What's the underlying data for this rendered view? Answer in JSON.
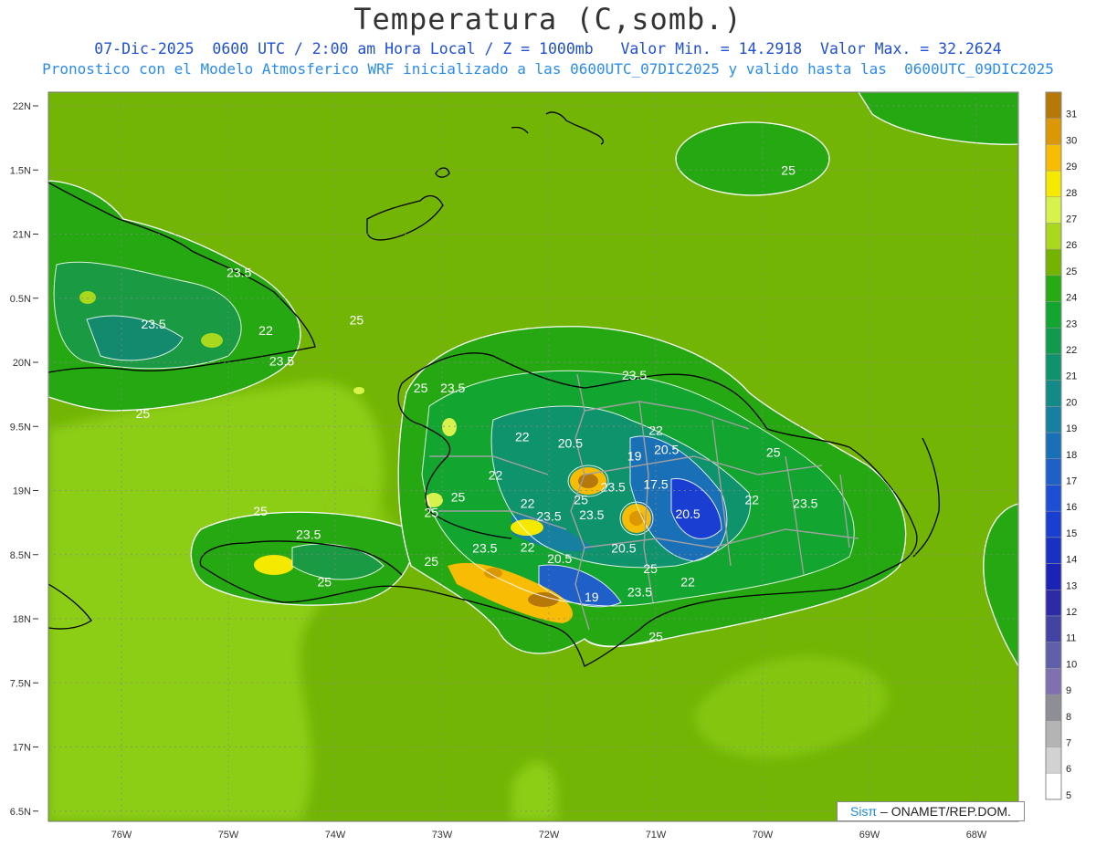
{
  "header": {
    "title": "Temperatura (C,somb.)",
    "line1": "07-Dic-2025  0600 UTC / 2:00 am Hora Local / Z = 1000mb   Valor Min. = 14.2918  Valor Max. = 32.2624",
    "line2": "Pronostico con el Modelo Atmosferico WRF inicializado a las 0600UTC_07DIC2025 y valido hasta las  0600UTC_09DIC2025"
  },
  "map": {
    "lon_labels": [
      "76W",
      "75W",
      "74W",
      "73W",
      "72W",
      "71W",
      "70W",
      "69W",
      "68W"
    ],
    "lat_labels": [
      "22N",
      "1.5N",
      "21N",
      "0.5N",
      "20N",
      "9.5N",
      "19N",
      "8.5N",
      "18N",
      "7.5N",
      "17N",
      "6.5N"
    ],
    "contour_labels": [
      {
        "text": "25",
        "lon": -69.76,
        "lat": 21.5
      },
      {
        "text": "23.5",
        "lon": -74.9,
        "lat": 20.7
      },
      {
        "text": "23.5",
        "lon": -75.7,
        "lat": 20.3
      },
      {
        "text": "22",
        "lon": -74.65,
        "lat": 20.25
      },
      {
        "text": "23.5",
        "lon": -74.5,
        "lat": 20.01
      },
      {
        "text": "25",
        "lon": -73.8,
        "lat": 20.33
      },
      {
        "text": "25",
        "lon": -75.8,
        "lat": 19.6
      },
      {
        "text": "25",
        "lon": -73.2,
        "lat": 19.8
      },
      {
        "text": "23.5",
        "lon": -72.9,
        "lat": 19.8
      },
      {
        "text": "23.5",
        "lon": -71.2,
        "lat": 19.9
      },
      {
        "text": "22",
        "lon": -72.25,
        "lat": 19.42
      },
      {
        "text": "20.5",
        "lon": -71.8,
        "lat": 19.37
      },
      {
        "text": "19",
        "lon": -71.2,
        "lat": 19.27
      },
      {
        "text": "22",
        "lon": -71.0,
        "lat": 19.47
      },
      {
        "text": "20.5",
        "lon": -70.9,
        "lat": 19.32
      },
      {
        "text": "25",
        "lon": -69.9,
        "lat": 19.3
      },
      {
        "text": "25",
        "lon": -72.85,
        "lat": 18.95
      },
      {
        "text": "22",
        "lon": -72.5,
        "lat": 19.12
      },
      {
        "text": "22",
        "lon": -72.2,
        "lat": 18.9
      },
      {
        "text": "25",
        "lon": -71.7,
        "lat": 18.93
      },
      {
        "text": "23.5",
        "lon": -71.4,
        "lat": 19.03
      },
      {
        "text": "17.5",
        "lon": -71.0,
        "lat": 19.05
      },
      {
        "text": "20.5",
        "lon": -70.7,
        "lat": 18.82
      },
      {
        "text": "22",
        "lon": -70.1,
        "lat": 18.93
      },
      {
        "text": "23.5",
        "lon": -69.6,
        "lat": 18.9
      },
      {
        "text": "25",
        "lon": -73.1,
        "lat": 18.83
      },
      {
        "text": "23.5",
        "lon": -72.0,
        "lat": 18.8
      },
      {
        "text": "23.5",
        "lon": -71.6,
        "lat": 18.81
      },
      {
        "text": "23.5",
        "lon": -72.6,
        "lat": 18.55
      },
      {
        "text": "22",
        "lon": -72.2,
        "lat": 18.56
      },
      {
        "text": "20.5",
        "lon": -71.9,
        "lat": 18.47
      },
      {
        "text": "20.5",
        "lon": -71.3,
        "lat": 18.55
      },
      {
        "text": "25",
        "lon": -71.05,
        "lat": 18.39
      },
      {
        "text": "25",
        "lon": -73.1,
        "lat": 18.45
      },
      {
        "text": "22",
        "lon": -70.7,
        "lat": 18.29
      },
      {
        "text": "19",
        "lon": -71.6,
        "lat": 18.17
      },
      {
        "text": "23.5",
        "lon": -71.15,
        "lat": 18.21
      },
      {
        "text": "25",
        "lon": -74.7,
        "lat": 18.84
      },
      {
        "text": "23.5",
        "lon": -74.25,
        "lat": 18.66
      },
      {
        "text": "25",
        "lon": -74.1,
        "lat": 18.29
      },
      {
        "text": "25",
        "lon": -71.0,
        "lat": 17.86
      }
    ]
  },
  "colorbar": {
    "levels": [
      "31",
      "30",
      "29",
      "28",
      "27",
      "26",
      "25",
      "24",
      "23",
      "22",
      "21",
      "20",
      "19",
      "18",
      "17",
      "16",
      "15",
      "14",
      "13",
      "12",
      "11",
      "10",
      "9",
      "8",
      "7",
      "6",
      "5"
    ],
    "colors": [
      "#b7780a",
      "#dc9705",
      "#f9bc05",
      "#f5e900",
      "#d8f24c",
      "#a9d81c",
      "#74b400",
      "#26ab12",
      "#12a52f",
      "#0f9b4b",
      "#0f936c",
      "#128a88",
      "#1780a0",
      "#1a70b6",
      "#1e5fc8",
      "#1d4fd4",
      "#1a3ed2",
      "#1830c4",
      "#1b22b6",
      "#2d2aa8",
      "#4343a4",
      "#6060aa",
      "#8070b0",
      "#8e8e96",
      "#b4b4b4",
      "#d2d2d2",
      "#ffffff"
    ],
    "field_colors": {
      "bg_light": "#8ccd12",
      "bg_mid": "#72b505",
      "warm1": "#26a812",
      "land": "#1f9f2e"
    }
  },
  "credit": {
    "sis": "Sisπ",
    "org": " – ONAMET/REP.DOM."
  }
}
